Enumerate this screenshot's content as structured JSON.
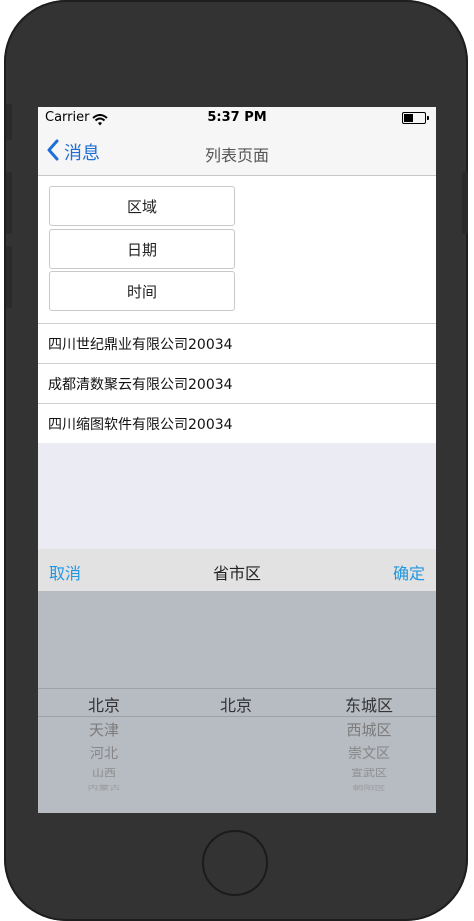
{
  "status_bar": {
    "carrier": "Carrier",
    "time": "5:37 PM"
  },
  "nav": {
    "back_label": "消息",
    "title": "列表页面"
  },
  "buttons": {
    "region": "区域",
    "date": "日期",
    "time": "时间"
  },
  "list": [
    "四川世纪鼎业有限公司20034",
    "成都清数聚云有限公司20034",
    "四川缩图软件有限公司20034"
  ],
  "picker": {
    "cancel_label": "取消",
    "title": "省市区",
    "confirm_label": "确定",
    "provinces": [
      "北京",
      "天津",
      "河北",
      "山西",
      "内蒙古"
    ],
    "cities": [
      "北京"
    ],
    "districts": [
      "东城区",
      "西城区",
      "崇文区",
      "宣武区",
      "朝阳区"
    ]
  },
  "colors": {
    "accent": "#2196e0",
    "nav_link": "#1f6fd6",
    "phone_body": "#333333",
    "picker_bg": "#b7bbc2"
  }
}
